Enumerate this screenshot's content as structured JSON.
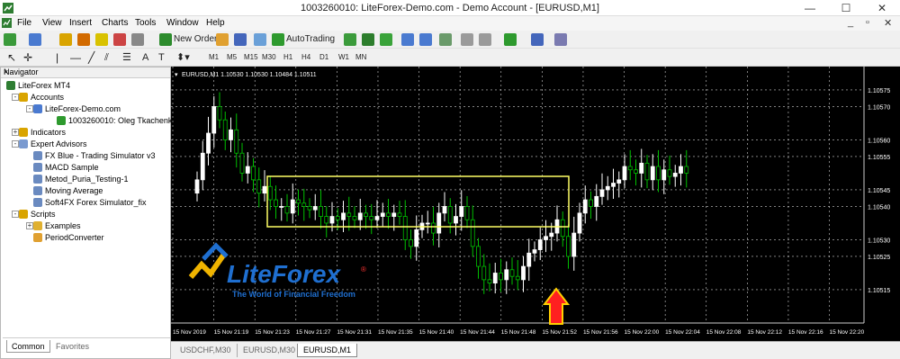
{
  "window": {
    "title": "1003260010: LiteForex-Demo.com - Demo Account - [EURUSD,M1]",
    "controls": [
      "—",
      "☐",
      "✕"
    ],
    "mdi_controls": [
      "_",
      "▫",
      "✕"
    ]
  },
  "menu": [
    "File",
    "View",
    "Insert",
    "Charts",
    "Tools",
    "Window",
    "Help"
  ],
  "toolbar": {
    "new_order": "New Order",
    "autotrading": "AutoTrading",
    "timeframes": [
      "M1",
      "M5",
      "M15",
      "M30",
      "H1",
      "H4",
      "D1",
      "W1",
      "MN"
    ]
  },
  "navigator": {
    "title": "Navigator",
    "close": "×",
    "tree": [
      {
        "label": "LiteForex MT4",
        "level": 0,
        "icon": "terminal-icon"
      },
      {
        "label": "Accounts",
        "level": 1,
        "icon": "accounts-icon",
        "toggle": "-"
      },
      {
        "label": "LiteForex-Demo.com",
        "level": 2,
        "icon": "server-icon",
        "toggle": "-"
      },
      {
        "label": "1003260010: Oleg Tkachenko-N",
        "level": 3,
        "icon": "user-icon"
      },
      {
        "label": "Indicators",
        "level": 1,
        "icon": "indicators-icon",
        "toggle": "+"
      },
      {
        "label": "Expert Advisors",
        "level": 1,
        "icon": "experts-icon",
        "toggle": "-"
      },
      {
        "label": "FX Blue - Trading Simulator v3",
        "level": 2,
        "icon": "expert-icon"
      },
      {
        "label": "MACD Sample",
        "level": 2,
        "icon": "expert-icon"
      },
      {
        "label": "Metod_Puria_Testing-1",
        "level": 2,
        "icon": "expert-icon"
      },
      {
        "label": "Moving Average",
        "level": 2,
        "icon": "expert-icon"
      },
      {
        "label": "Soft4FX Forex Simulator_fix",
        "level": 2,
        "icon": "expert-icon"
      },
      {
        "label": "Scripts",
        "level": 1,
        "icon": "scripts-icon",
        "toggle": "-"
      },
      {
        "label": "Examples",
        "level": 2,
        "icon": "folder-icon",
        "toggle": "+"
      },
      {
        "label": "PeriodConverter",
        "level": 2,
        "icon": "script-icon"
      }
    ],
    "tabs": [
      "Common",
      "Favorites"
    ]
  },
  "chart": {
    "header": "EURUSD,M1  1.10530 1.10530 1.10484 1.10511",
    "logo_text": "LiteForex",
    "logo_reg": "®",
    "logo_tagline": "The World of Financial Freedom",
    "colors": {
      "bull": "#ffffff",
      "bear": "#00c000",
      "bg": "#000000",
      "grid": "#cfcfcf",
      "box": "#ffff66",
      "arrow_fill": "#ff2020",
      "arrow_stroke": "#ffd000",
      "logo_blue": "#1f6fd0"
    }
  },
  "chart_data": {
    "type": "candlestick",
    "symbol": "EURUSD",
    "timeframe": "M1",
    "y_ticks": [
      "1.10575",
      "1.10560",
      "1.10545",
      "1.10530",
      "1.10515"
    ],
    "y_ticks_more": [
      "1.10570",
      "1.10555",
      "1.10540",
      "1.10525"
    ],
    "ylim": [
      1.10505,
      1.10582
    ],
    "x_ticks": [
      "15 Nov 2019",
      "15 Nov 21:19",
      "15 Nov 21:23",
      "15 Nov 21:27",
      "15 Nov 21:31",
      "15 Nov 21:35",
      "15 Nov 21:40",
      "15 Nov 21:44",
      "15 Nov 21:48",
      "15 Nov 21:52",
      "15 Nov 21:56",
      "15 Nov 22:00",
      "15 Nov 22:04",
      "15 Nov 22:08",
      "15 Nov 22:12",
      "15 Nov 22:16",
      "15 Nov 22:20"
    ]
  },
  "chart_tabs": [
    "USDCHF,M30",
    "EURUSD,M30",
    "EURUSD,M1"
  ]
}
